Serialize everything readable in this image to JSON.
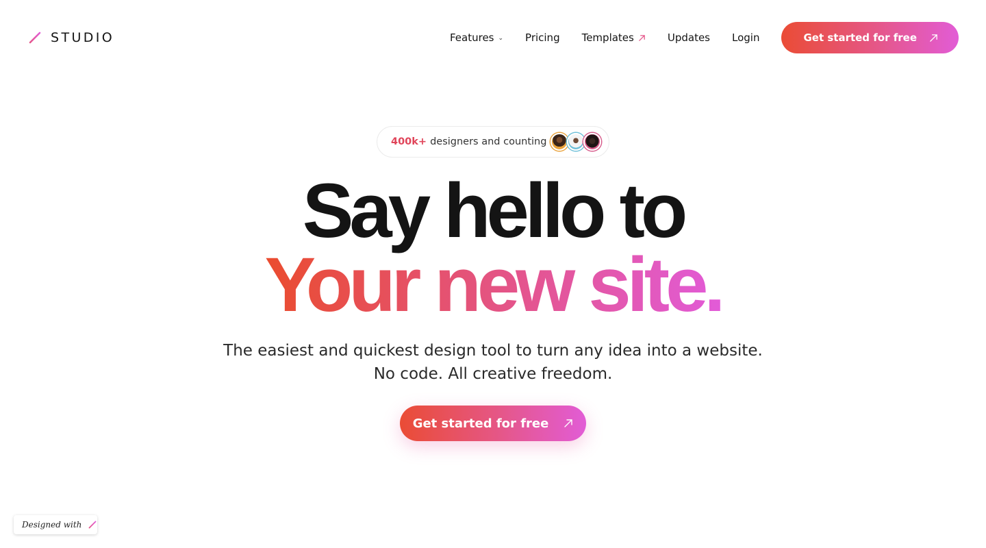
{
  "brand": {
    "name": "STUDIO",
    "accent": "#e5578a"
  },
  "nav": {
    "items": [
      {
        "label": "Features",
        "icon": "chevron-down-icon"
      },
      {
        "label": "Pricing"
      },
      {
        "label": "Templates",
        "icon": "external-arrow-icon"
      },
      {
        "label": "Updates"
      },
      {
        "label": "Login"
      }
    ],
    "cta_label": "Get started for free"
  },
  "pill": {
    "count": "400k+",
    "text": "designers and counting"
  },
  "hero": {
    "line1": "Say hello to",
    "line2": "Your new site.",
    "subtitle_line1": "The easiest and quickest design tool to turn any idea into a website.",
    "subtitle_line2": "No code. All creative freedom.",
    "cta_label": "Get started for free"
  },
  "badge": {
    "text": "Designed with"
  },
  "colors": {
    "gradient_start": "#ea4c35",
    "gradient_mid": "#e5578a",
    "gradient_end": "#e25cd6",
    "text": "#141414"
  }
}
